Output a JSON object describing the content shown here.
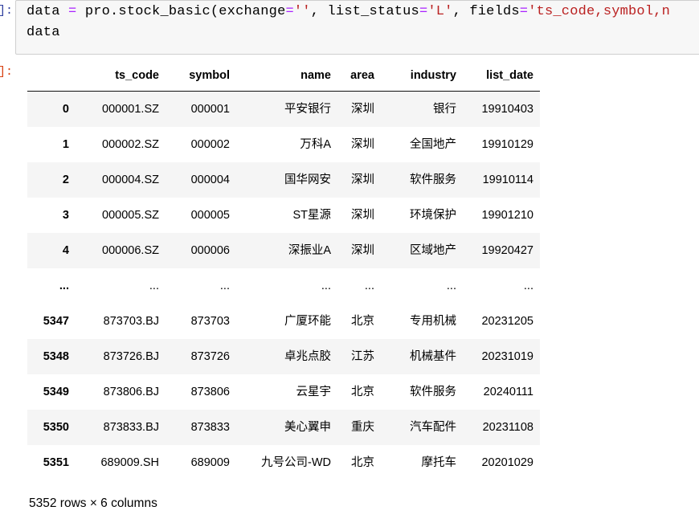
{
  "cell": {
    "input_prompt": "]:",
    "output_prompt": "]:",
    "code_lines": [
      [
        {
          "t": "name",
          "v": "data "
        },
        {
          "t": "op",
          "v": "="
        },
        {
          "t": "name",
          "v": " pro.stock_basic"
        },
        {
          "t": "punc",
          "v": "("
        },
        {
          "t": "name",
          "v": "exchange"
        },
        {
          "t": "op",
          "v": "="
        },
        {
          "t": "str",
          "v": "''"
        },
        {
          "t": "punc",
          "v": ", "
        },
        {
          "t": "name",
          "v": "list_status"
        },
        {
          "t": "op",
          "v": "="
        },
        {
          "t": "str",
          "v": "'L'"
        },
        {
          "t": "punc",
          "v": ", "
        },
        {
          "t": "name",
          "v": "fields"
        },
        {
          "t": "op",
          "v": "="
        },
        {
          "t": "str",
          "v": "'ts_code,symbol,n"
        }
      ],
      [
        {
          "t": "name",
          "v": "data"
        }
      ]
    ]
  },
  "dataframe": {
    "index_header": "",
    "columns": [
      "ts_code",
      "symbol",
      "name",
      "area",
      "industry",
      "list_date"
    ],
    "rows": [
      {
        "index": "0",
        "cells": [
          "000001.SZ",
          "000001",
          "平安银行",
          "深圳",
          "银行",
          "19910403"
        ]
      },
      {
        "index": "1",
        "cells": [
          "000002.SZ",
          "000002",
          "万科A",
          "深圳",
          "全国地产",
          "19910129"
        ]
      },
      {
        "index": "2",
        "cells": [
          "000004.SZ",
          "000004",
          "国华网安",
          "深圳",
          "软件服务",
          "19910114"
        ]
      },
      {
        "index": "3",
        "cells": [
          "000005.SZ",
          "000005",
          "ST星源",
          "深圳",
          "环境保护",
          "19901210"
        ]
      },
      {
        "index": "4",
        "cells": [
          "000006.SZ",
          "000006",
          "深振业A",
          "深圳",
          "区域地产",
          "19920427"
        ]
      },
      {
        "index": "...",
        "cells": [
          "...",
          "...",
          "...",
          "...",
          "...",
          "..."
        ],
        "ellipsis": true
      },
      {
        "index": "5347",
        "cells": [
          "873703.BJ",
          "873703",
          "广厦环能",
          "北京",
          "专用机械",
          "20231205"
        ]
      },
      {
        "index": "5348",
        "cells": [
          "873726.BJ",
          "873726",
          "卓兆点胶",
          "江苏",
          "机械基件",
          "20231019"
        ]
      },
      {
        "index": "5349",
        "cells": [
          "873806.BJ",
          "873806",
          "云星宇",
          "北京",
          "软件服务",
          "20240111"
        ]
      },
      {
        "index": "5350",
        "cells": [
          "873833.BJ",
          "873833",
          "美心翼申",
          "重庆",
          "汽车配件",
          "20231108"
        ]
      },
      {
        "index": "5351",
        "cells": [
          "689009.SH",
          "689009",
          "九号公司-WD",
          "北京",
          "摩托车",
          "20201029"
        ]
      }
    ],
    "footer": "5352 rows × 6 columns"
  },
  "colors": {
    "prompt_in": "#303F9F",
    "prompt_out": "#D84315",
    "code_bg": "#f7f7f7",
    "string": "#BA2121",
    "operator": "#AA22FF",
    "row_stripe": "#f5f5f5"
  }
}
